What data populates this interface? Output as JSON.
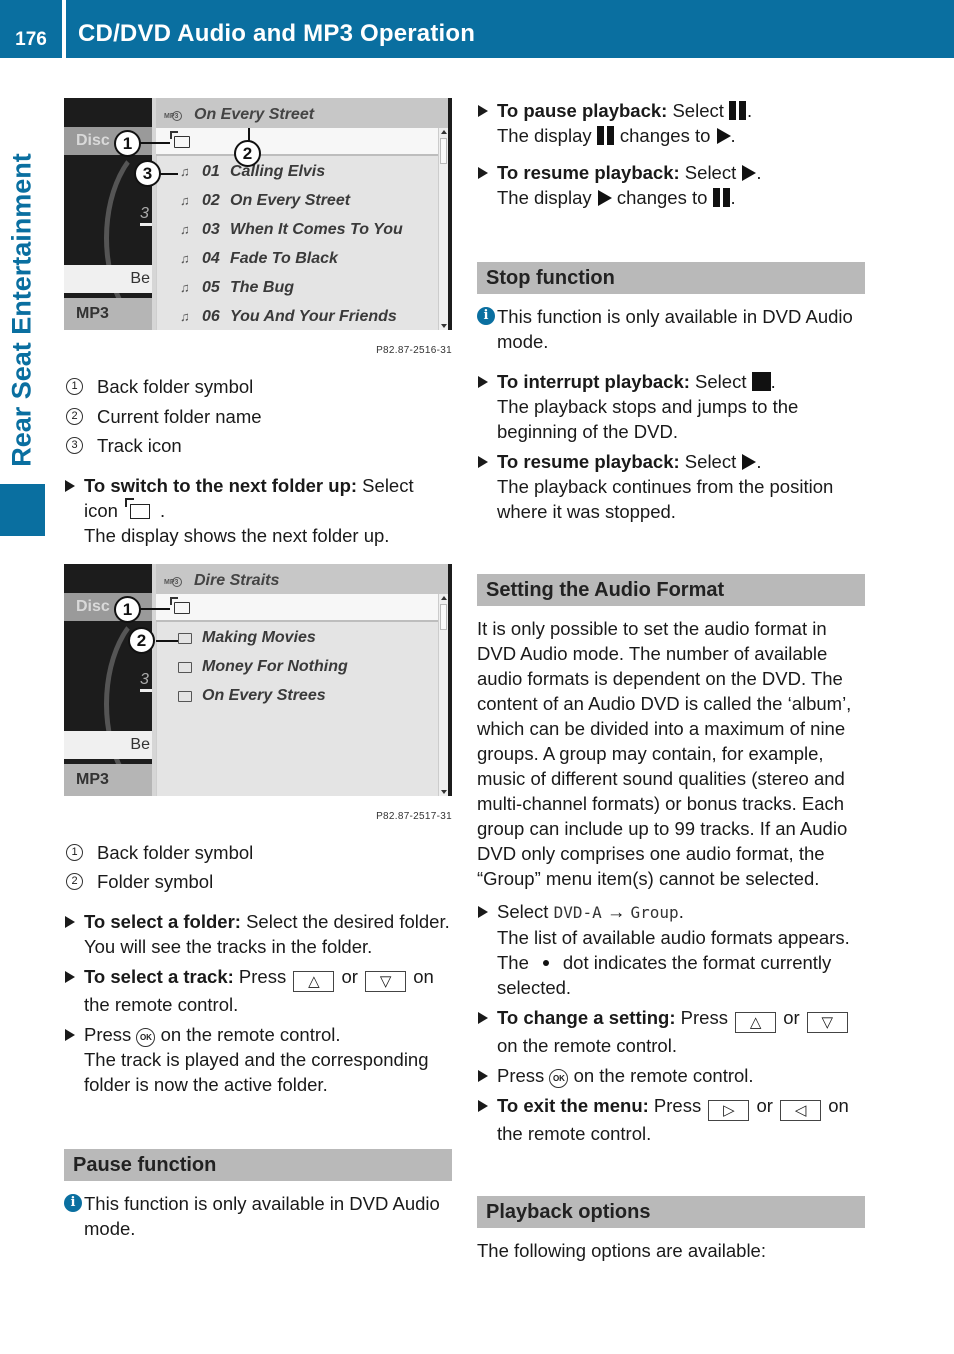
{
  "header": {
    "page_number": "176",
    "title": "CD/DVD Audio and MP3 Operation"
  },
  "side_tab": {
    "label": "Rear Seat Entertainment",
    "accent_color": "#0a6fa0"
  },
  "screenshot1": {
    "left_labels": {
      "disc": "Disc",
      "be": "Be",
      "mp3": "MP3",
      "number": "3"
    },
    "folder_title": "On Every Street",
    "mp3_badge": "MP3",
    "tracks": [
      {
        "num": "01",
        "name": "Calling Elvis"
      },
      {
        "num": "02",
        "name": "On Every Street"
      },
      {
        "num": "03",
        "name": "When It Comes To You"
      },
      {
        "num": "04",
        "name": "Fade To Black"
      },
      {
        "num": "05",
        "name": "The Bug"
      },
      {
        "num": "06",
        "name": "You And Your Friends"
      }
    ],
    "callouts": [
      "1",
      "2",
      "3"
    ],
    "caption": "P82.87-2516-31"
  },
  "legend1": [
    {
      "num": "1",
      "text": "Back folder symbol"
    },
    {
      "num": "2",
      "text": "Current folder name"
    },
    {
      "num": "3",
      "text": "Track icon"
    }
  ],
  "step_folder_up": {
    "bold": "To switch to the next folder up:",
    "text1": " Select",
    "text2": "icon",
    "text3": ".",
    "sub": "The display shows the next folder up."
  },
  "screenshot2": {
    "left_labels": {
      "disc": "Disc",
      "be": "Be",
      "mp3": "MP3",
      "number": "3"
    },
    "folder_title": "Dire Straits",
    "mp3_badge": "MP3",
    "folders": [
      "Making Movies",
      "Money For Nothing",
      "On Every Strees"
    ],
    "callouts": [
      "1",
      "2"
    ],
    "caption": "P82.87-2517-31"
  },
  "legend2": [
    {
      "num": "1",
      "text": "Back folder symbol"
    },
    {
      "num": "2",
      "text": "Folder symbol"
    }
  ],
  "steps_left": {
    "select_folder": {
      "bold": "To select a folder:",
      "text": " Select the desired folder.",
      "sub": "You will see the tracks in the folder."
    },
    "select_track": {
      "bold": "To select a track:",
      "text1": " Press ",
      "key_up": "△",
      "or": " or ",
      "key_down": "▽",
      "text2": " on the remote control."
    },
    "press_ok": {
      "text1": "Press ",
      "ok": "OK",
      "text2": " on the remote control.",
      "sub": "The track is played and the corresponding folder is now the active folder."
    }
  },
  "pause_section": {
    "heading": "Pause function",
    "info": "This function is only available in DVD Audio mode."
  },
  "right_top": {
    "pause": {
      "bold": "To pause playback:",
      "text": " Select ",
      "sub1": "The display ",
      "sub2": " changes to ",
      "end": "."
    },
    "resume": {
      "bold": "To resume playback:",
      "text": " Select ",
      "sub1": "The display ",
      "sub2": " changes to ",
      "end": "."
    }
  },
  "stop_section": {
    "heading": "Stop function",
    "info": "This function is only available in DVD Audio mode.",
    "interrupt": {
      "bold": "To interrupt playback:",
      "text": " Select ",
      "end": ".",
      "sub": "The playback stops and jumps to the beginning of the DVD."
    },
    "resume": {
      "bold": "To resume playback:",
      "text": " Select ",
      "end": ".",
      "sub": "The playback continues from the position where it was stopped."
    }
  },
  "audio_format_section": {
    "heading": "Setting the Audio Format",
    "body": "It is only possible to set the audio format in DVD Audio mode. The number of available audio formats is dependent on the DVD. The content of an Audio DVD is called the ‘album’, which can be divided into a maximum of nine groups. A group may contain, for example, music of different sound qualities (stereo and multi-channel formats) or bonus tracks. Each group can include up to 99 tracks. If an Audio DVD only comprises one audio format, the “Group” menu item(s) cannot be selected.",
    "select": {
      "text": "Select ",
      "menu1": "DVD-A",
      "arrow": " → ",
      "menu2": "Group",
      "end": ".",
      "sub1": "The list of available audio formats appears.",
      "sub2a": "The",
      "sub2b": "dot indicates the format currently selected."
    },
    "change": {
      "bold": "To change a setting:",
      "text1": " Press ",
      "key_up": "△",
      "or": " or ",
      "key_down": "▽",
      "text2": " on the remote control."
    },
    "press_ok": {
      "text1": "Press ",
      "ok": "OK",
      "text2": " on the remote control."
    },
    "exit": {
      "bold": "To exit the menu:",
      "text1": " Press ",
      "key_right": "▷",
      "or": " or ",
      "key_left": "◁",
      "text2": " on the remote control."
    }
  },
  "playback_options_section": {
    "heading": "Playback options",
    "body": "The following options are available:"
  }
}
